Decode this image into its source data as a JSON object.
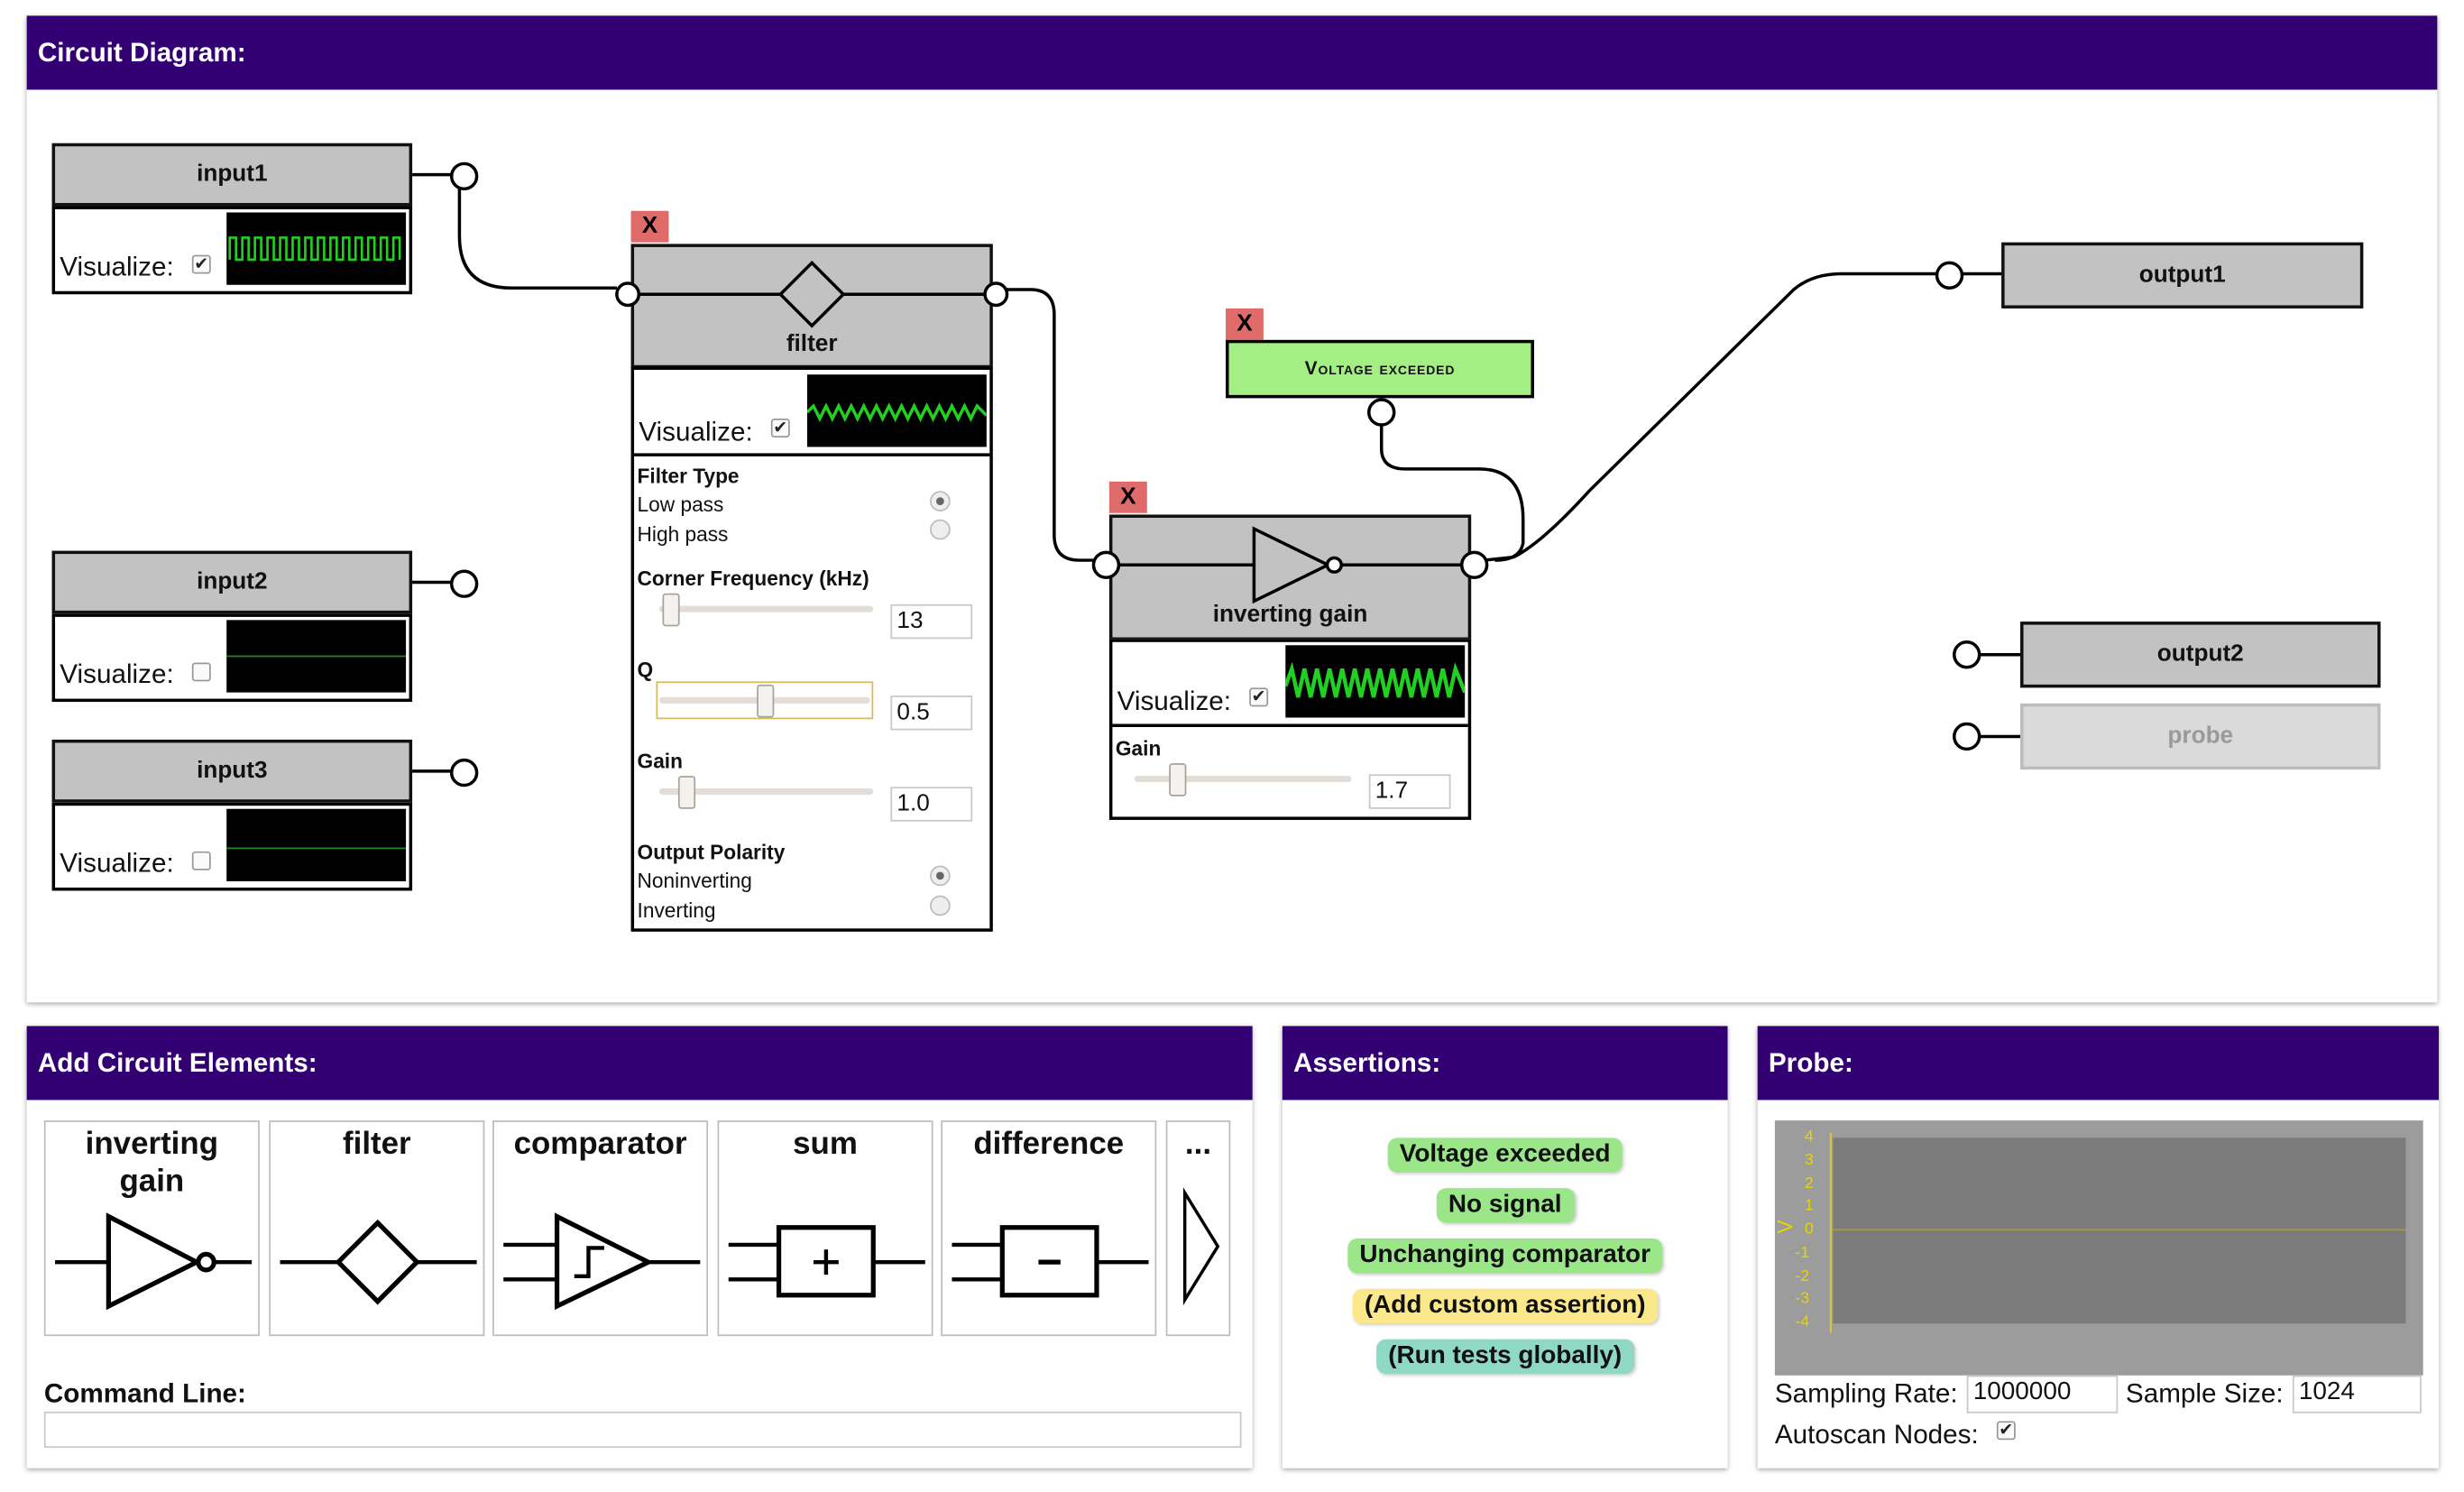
{
  "circuit_panel": {
    "title": "Circuit Diagram:"
  },
  "inputs": [
    {
      "name": "input1",
      "visualize_label": "Visualize:",
      "visualize_checked": true,
      "checkmark": "✔"
    },
    {
      "name": "input2",
      "visualize_label": "Visualize:",
      "visualize_checked": false,
      "checkmark": ""
    },
    {
      "name": "input3",
      "visualize_label": "Visualize:",
      "visualize_checked": false,
      "checkmark": ""
    }
  ],
  "filter": {
    "close_label": "X",
    "name": "filter",
    "visualize_label": "Visualize:",
    "checkmark": "✔",
    "filter_type_label": "Filter Type",
    "low_pass_label": "Low pass",
    "high_pass_label": "High pass",
    "selected_filter_type": "Low pass",
    "corner_frequency_label": "Corner Frequency (kHz)",
    "corner_frequency_value": "13",
    "q_label": "Q",
    "q_value": "0.5",
    "gain_label": "Gain",
    "gain_value": "1.0",
    "output_polarity_label": "Output Polarity",
    "noninverting_label": "Noninverting",
    "inverting_label": "Inverting",
    "selected_polarity": "Noninverting"
  },
  "inverting_gain": {
    "close_label": "X",
    "name": "inverting gain",
    "visualize_label": "Visualize:",
    "checkmark": "✔",
    "gain_label": "Gain",
    "gain_value": "1.7"
  },
  "assertion_block": {
    "close_label": "X",
    "label": "Voltage exceeded"
  },
  "outputs": [
    {
      "name": "output1"
    },
    {
      "name": "output2"
    },
    {
      "name": "probe"
    }
  ],
  "add_elements_panel": {
    "title": "Add Circuit Elements:",
    "items": [
      {
        "label": "inverting gain",
        "icon": "inverting-gain-icon"
      },
      {
        "label": "filter",
        "icon": "filter-icon"
      },
      {
        "label": "comparator",
        "icon": "comparator-icon"
      },
      {
        "label": "sum",
        "icon": "sum-icon"
      },
      {
        "label": "difference",
        "icon": "difference-icon"
      },
      {
        "label": "...",
        "icon": "more-icon"
      }
    ],
    "command_line_label": "Command Line:",
    "command_line_value": ""
  },
  "assertions_panel": {
    "title": "Assertions:",
    "items": [
      {
        "label": "Voltage exceeded",
        "color": "#9ce68a"
      },
      {
        "label": "No signal",
        "color": "#9ce68a"
      },
      {
        "label": "Unchanging comparator",
        "color": "#9ce68a"
      },
      {
        "label": "(Add custom assertion)",
        "color": "#fbe88a"
      },
      {
        "label": "(Run tests globally)",
        "color": "#8fd9c4"
      }
    ]
  },
  "probe_panel": {
    "title": "Probe:",
    "y_axis_label": "V",
    "y_ticks": [
      "4",
      "3",
      "2",
      "1",
      "0",
      "-1",
      "-2",
      "-3",
      "-4"
    ],
    "sampling_rate_label": "Sampling Rate:",
    "sampling_rate_value": "1000000",
    "sample_size_label": "Sample Size:",
    "sample_size_value": "1024",
    "autoscan_label": "Autoscan Nodes:",
    "autoscan_checked": true,
    "checkmark": "✔"
  },
  "colors": {
    "header": "#320073",
    "block_gray": "#c2c2c2",
    "close_red": "#e06b6b",
    "waveform_green": "#22d022",
    "assertion_green": "#a3ef84",
    "probe_axis_yellow": "#e6d600"
  }
}
